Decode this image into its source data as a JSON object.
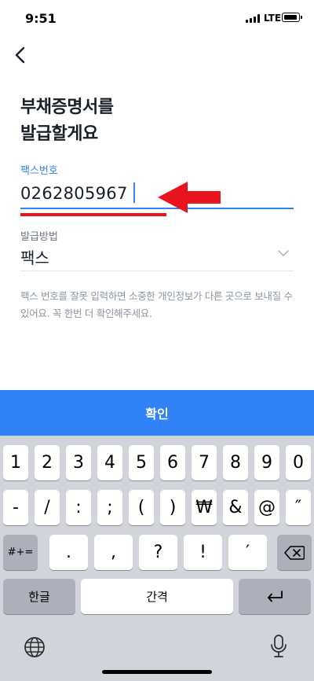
{
  "status_bar": {
    "time": "9:51",
    "network": "LTE"
  },
  "header": {
    "back_icon": "chevron-left-icon"
  },
  "title": {
    "line1": "부채증명서를",
    "line2": "발급할게요"
  },
  "fax_field": {
    "label": "팩스번호",
    "value": "0262805967"
  },
  "method_field": {
    "label": "발급방법",
    "value": "팩스"
  },
  "notice": "팩스 번호를 잘못 입력하면 소중한 개인정보가 다른 곳으로 보내질 수 있어요. 꼭 한번 더 확인해주세요.",
  "confirm_label": "확인",
  "colors": {
    "accent": "#3182f6",
    "annotation": "#e8141e"
  },
  "keyboard": {
    "row1": [
      "1",
      "2",
      "3",
      "4",
      "5",
      "6",
      "7",
      "8",
      "9",
      "0"
    ],
    "row2": [
      "-",
      "/",
      ":",
      ";",
      "(",
      ")",
      "₩",
      "&",
      "@",
      "″"
    ],
    "row3": {
      "shift_label": "#+=",
      "keys": [
        ".",
        ",",
        "?",
        "!",
        "′"
      ],
      "delete_icon": "backspace-icon"
    },
    "row4": {
      "lang_label": "한글",
      "space_label": "간격",
      "return_icon": "return-icon"
    },
    "bottom": {
      "globe_icon": "globe-icon",
      "mic_icon": "microphone-icon"
    }
  }
}
